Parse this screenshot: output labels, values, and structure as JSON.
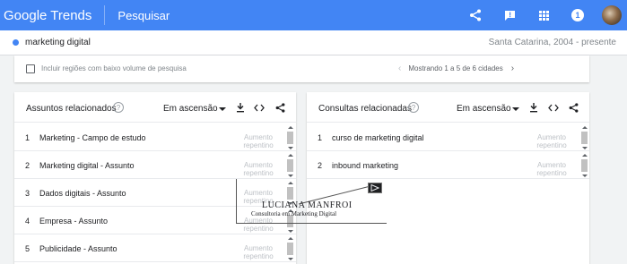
{
  "header": {
    "logo": "Google Trends",
    "section": "Pesquisar",
    "notification_count": "1",
    "icons": [
      "share-icon",
      "feedback-icon",
      "apps-grid-icon",
      "notification-badge",
      "avatar"
    ]
  },
  "term_bar": {
    "term": "marketing digital",
    "meta": "Santa Catarina, 2004 - presente"
  },
  "regions": {
    "checkbox_label": "Incluir regiões com baixo volume de pesquisa",
    "pagination": "Mostrando 1 a 5 de 6 cidades"
  },
  "topics_panel": {
    "title": "Assuntos relacionados",
    "sort": "Em ascensão",
    "rows": [
      {
        "rank": "1",
        "label": "Marketing - Campo de estudo",
        "value": "Aumento repentino"
      },
      {
        "rank": "2",
        "label": "Marketing digital - Assunto",
        "value": "Aumento repentino"
      },
      {
        "rank": "3",
        "label": "Dados digitais - Assunto",
        "value": "Aumento repentino"
      },
      {
        "rank": "4",
        "label": "Empresa - Assunto",
        "value": "Aumento repentino"
      },
      {
        "rank": "5",
        "label": "Publicidade - Assunto",
        "value": "Aumento repentino"
      }
    ]
  },
  "queries_panel": {
    "title": "Consultas relacionadas",
    "sort": "Em ascensão",
    "rows": [
      {
        "rank": "1",
        "label": "curso de marketing digital",
        "value": "Aumento repentino"
      },
      {
        "rank": "2",
        "label": "inbound marketing",
        "value": "Aumento repentino"
      }
    ]
  },
  "watermark": {
    "name": "LUCIANA MANFROI",
    "subtitle": "Consultoria em Marketing Digital"
  },
  "colors": {
    "header_bg": "#4285f4",
    "page_bg": "#f1f3f4",
    "muted_text": "#bdc1c6"
  }
}
